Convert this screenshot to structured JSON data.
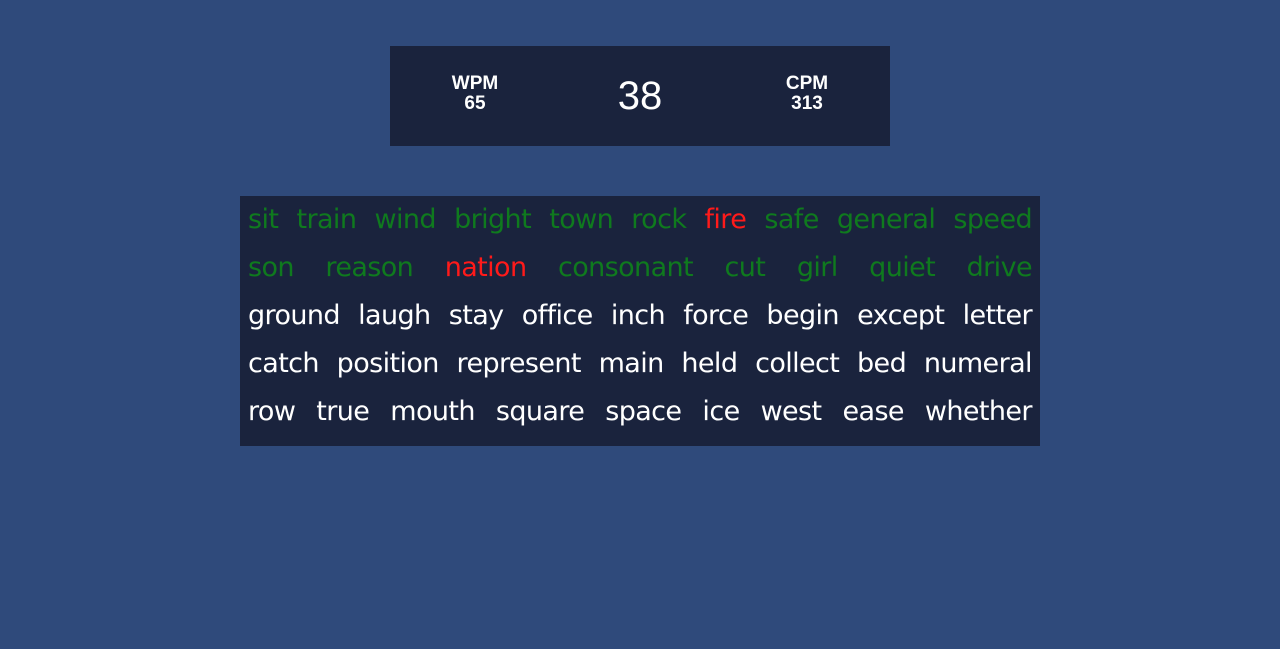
{
  "stats": {
    "wpm_label": "WPM",
    "wpm_value": "65",
    "timer": "38",
    "cpm_label": "CPM",
    "cpm_value": "313"
  },
  "colors": {
    "background": "#2f4a7b",
    "panel": "#1a233d",
    "correct": "#0f7a1e",
    "incorrect": "#ff1a1a",
    "pending": "#ffffff"
  },
  "lines": [
    [
      {
        "text": "sit",
        "status": "correct"
      },
      {
        "text": "train",
        "status": "correct"
      },
      {
        "text": "wind",
        "status": "correct"
      },
      {
        "text": "bright",
        "status": "correct"
      },
      {
        "text": "town",
        "status": "correct"
      },
      {
        "text": "rock",
        "status": "correct"
      },
      {
        "text": "fire",
        "status": "incorrect"
      },
      {
        "text": "safe",
        "status": "correct"
      },
      {
        "text": "general",
        "status": "correct"
      },
      {
        "text": "speed",
        "status": "correct"
      }
    ],
    [
      {
        "text": "son",
        "status": "correct"
      },
      {
        "text": "reason",
        "status": "correct"
      },
      {
        "text": "nation",
        "status": "incorrect"
      },
      {
        "text": "consonant",
        "status": "correct"
      },
      {
        "text": "cut",
        "status": "correct"
      },
      {
        "text": "girl",
        "status": "correct"
      },
      {
        "text": "quiet",
        "status": "correct"
      },
      {
        "text": "drive",
        "status": "correct"
      }
    ],
    [
      {
        "text": "ground",
        "status": "pending"
      },
      {
        "text": "laugh",
        "status": "pending"
      },
      {
        "text": "stay",
        "status": "pending"
      },
      {
        "text": "office",
        "status": "pending"
      },
      {
        "text": "inch",
        "status": "pending"
      },
      {
        "text": "force",
        "status": "pending"
      },
      {
        "text": "begin",
        "status": "pending"
      },
      {
        "text": "except",
        "status": "pending"
      },
      {
        "text": "letter",
        "status": "pending"
      }
    ],
    [
      {
        "text": "catch",
        "status": "pending"
      },
      {
        "text": "position",
        "status": "pending"
      },
      {
        "text": "represent",
        "status": "pending"
      },
      {
        "text": "main",
        "status": "pending"
      },
      {
        "text": "held",
        "status": "pending"
      },
      {
        "text": "collect",
        "status": "pending"
      },
      {
        "text": "bed",
        "status": "pending"
      },
      {
        "text": "numeral",
        "status": "pending"
      }
    ],
    [
      {
        "text": "row",
        "status": "pending"
      },
      {
        "text": "true",
        "status": "pending"
      },
      {
        "text": "mouth",
        "status": "pending"
      },
      {
        "text": "square",
        "status": "pending"
      },
      {
        "text": "space",
        "status": "pending"
      },
      {
        "text": "ice",
        "status": "pending"
      },
      {
        "text": "west",
        "status": "pending"
      },
      {
        "text": "ease",
        "status": "pending"
      },
      {
        "text": "whether",
        "status": "pending"
      }
    ]
  ]
}
